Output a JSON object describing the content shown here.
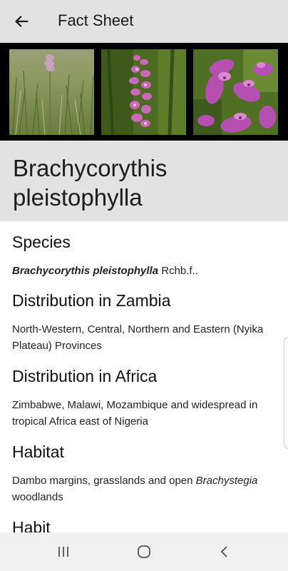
{
  "appbar": {
    "title": "Fact Sheet",
    "back_icon": "arrow-left-icon"
  },
  "gallery": {
    "images": [
      "orchid-grass-photo",
      "orchid-spike-photo",
      "orchid-flower-closeup-photo"
    ]
  },
  "plant": {
    "name": "Brachycorythis pleistophylla"
  },
  "sections": {
    "species": {
      "heading": "Species",
      "name_italic": "Brachycorythis pleistophylla",
      "author": " Rchb.f.."
    },
    "zambia": {
      "heading": "Distribution in Zambia",
      "text": "North-Western, Central, Northern and Eastern (Nyika Plateau) Provinces"
    },
    "africa": {
      "heading": "Distribution in Africa",
      "text": "Zimbabwe, Malawi, Mozambique and widespread in tropical Africa east of Nigeria"
    },
    "habitat": {
      "heading": "Habitat",
      "text_before": "Dambo margins, grasslands and open ",
      "text_italic": "Brachystegia",
      "text_after": " woodlands"
    },
    "habit": {
      "heading": "Habit"
    }
  },
  "navbar": {
    "recents_icon": "recents-icon",
    "home_icon": "home-icon",
    "back_icon": "nav-back-icon"
  },
  "colors": {
    "appbar_bg": "#e2e2e2",
    "gallery_bg": "#000000",
    "navbar_bg": "#f0f0f0",
    "orchid_pink": "#c15bb9"
  }
}
